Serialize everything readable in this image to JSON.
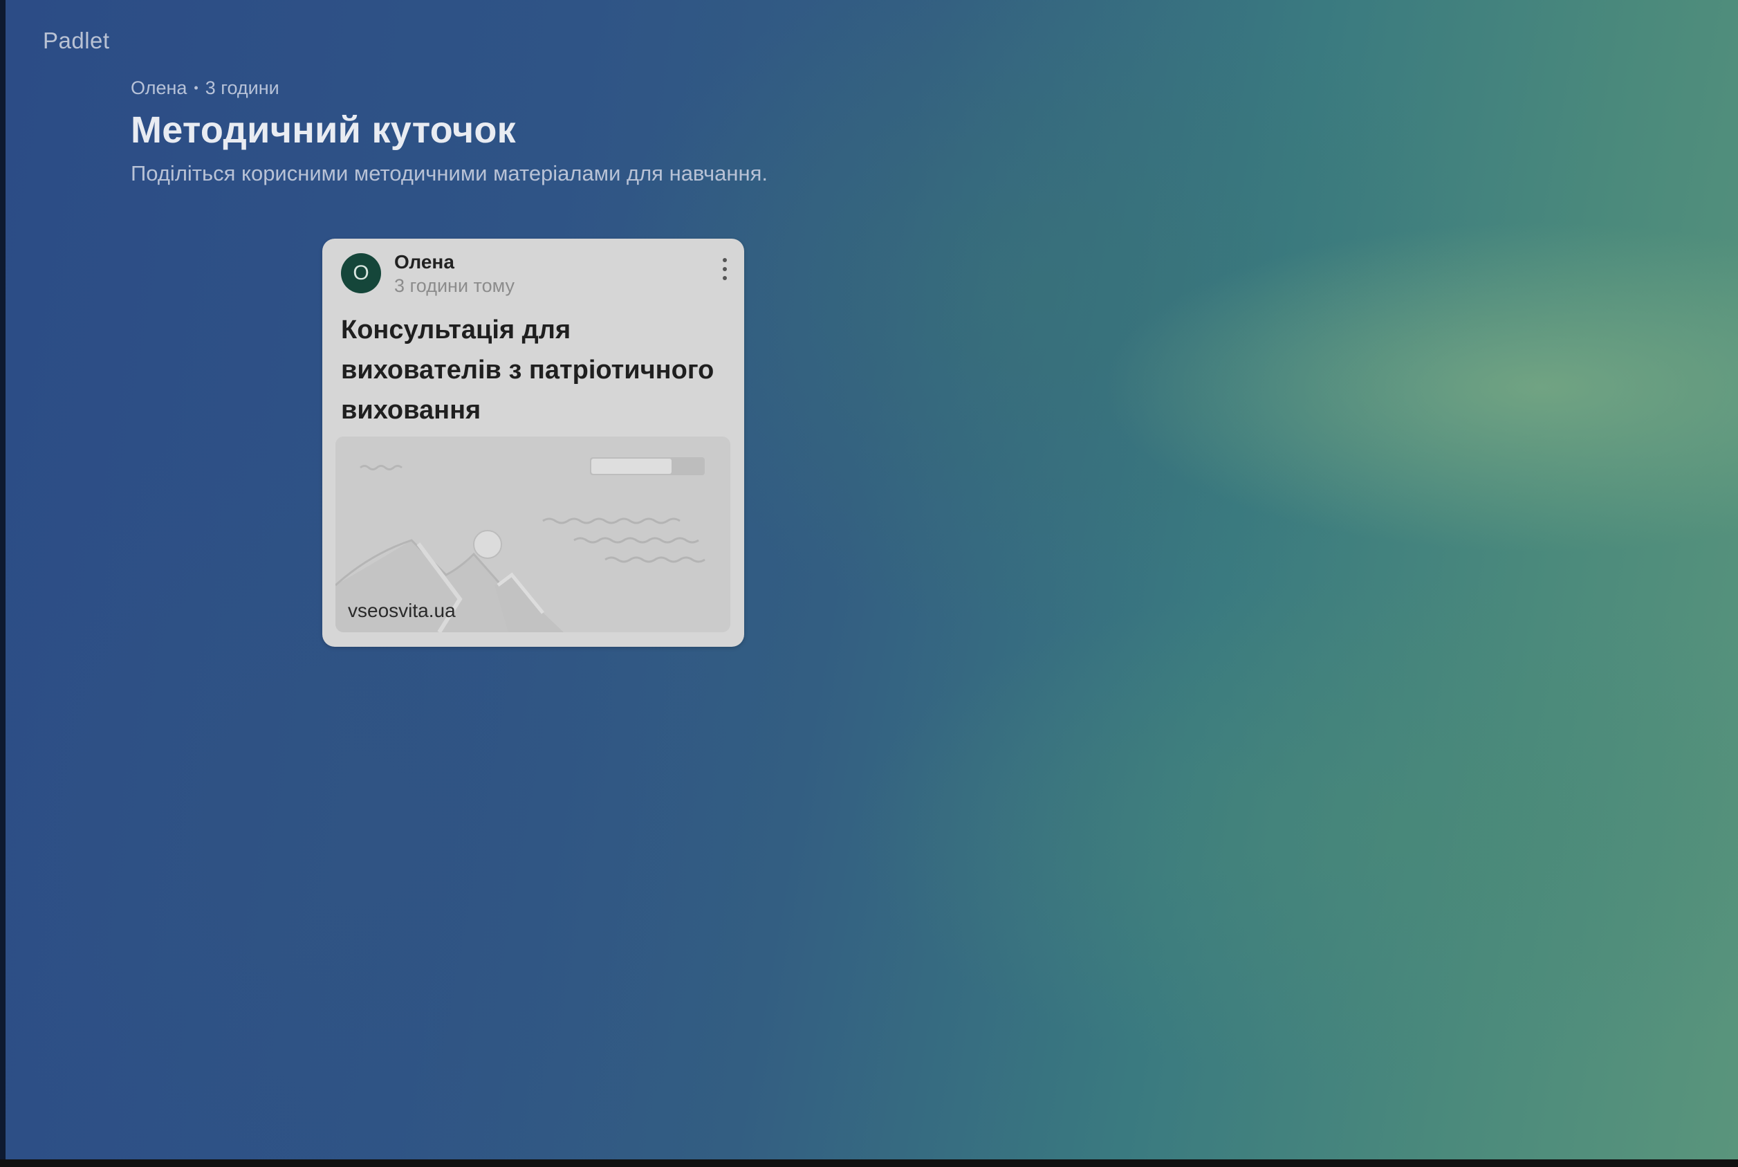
{
  "app": {
    "logo": "Padlet"
  },
  "board": {
    "meta_author": "Олена",
    "meta_separator": "•",
    "meta_time": "3 години",
    "title": "Методичний куточок",
    "description": "Поділіться корисними методичними матеріалами для навчання."
  },
  "posts": [
    {
      "avatar_initial": "О",
      "author": "Олена",
      "time": "3 години тому",
      "title": "Консультація для вихователів з патріотичного виховання",
      "link_domain": "vseosvita.ua",
      "menu_icon": "more-vertical-icon",
      "preview_icon": "image-placeholder-icon"
    }
  ],
  "colors": {
    "avatar_bg": "#15463a",
    "card_bg": "#d6d6d6",
    "board_bg_left": "#2c4c86",
    "board_bg_right": "#5a957c"
  }
}
